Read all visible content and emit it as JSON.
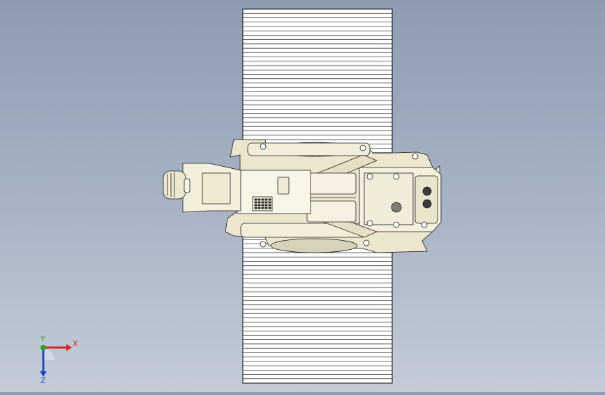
{
  "viewport": {
    "background_top": "#8d9cb1",
    "background_bottom": "#c3ccd7",
    "part_color": "#f1ecd8",
    "part_shade": "#c8c0a2",
    "edge_color": "#1b1b1b"
  },
  "model": {
    "track_belt": {
      "rib_count": 86
    },
    "arm_end_icon": "lens-icon",
    "ball_icon": "sphere-icon"
  },
  "triad": {
    "x_label": "X",
    "y_label": "Y",
    "z_label": "Z",
    "x_color": "#e0231b",
    "y_color": "#2aa52a",
    "z_color": "#2346c8"
  }
}
